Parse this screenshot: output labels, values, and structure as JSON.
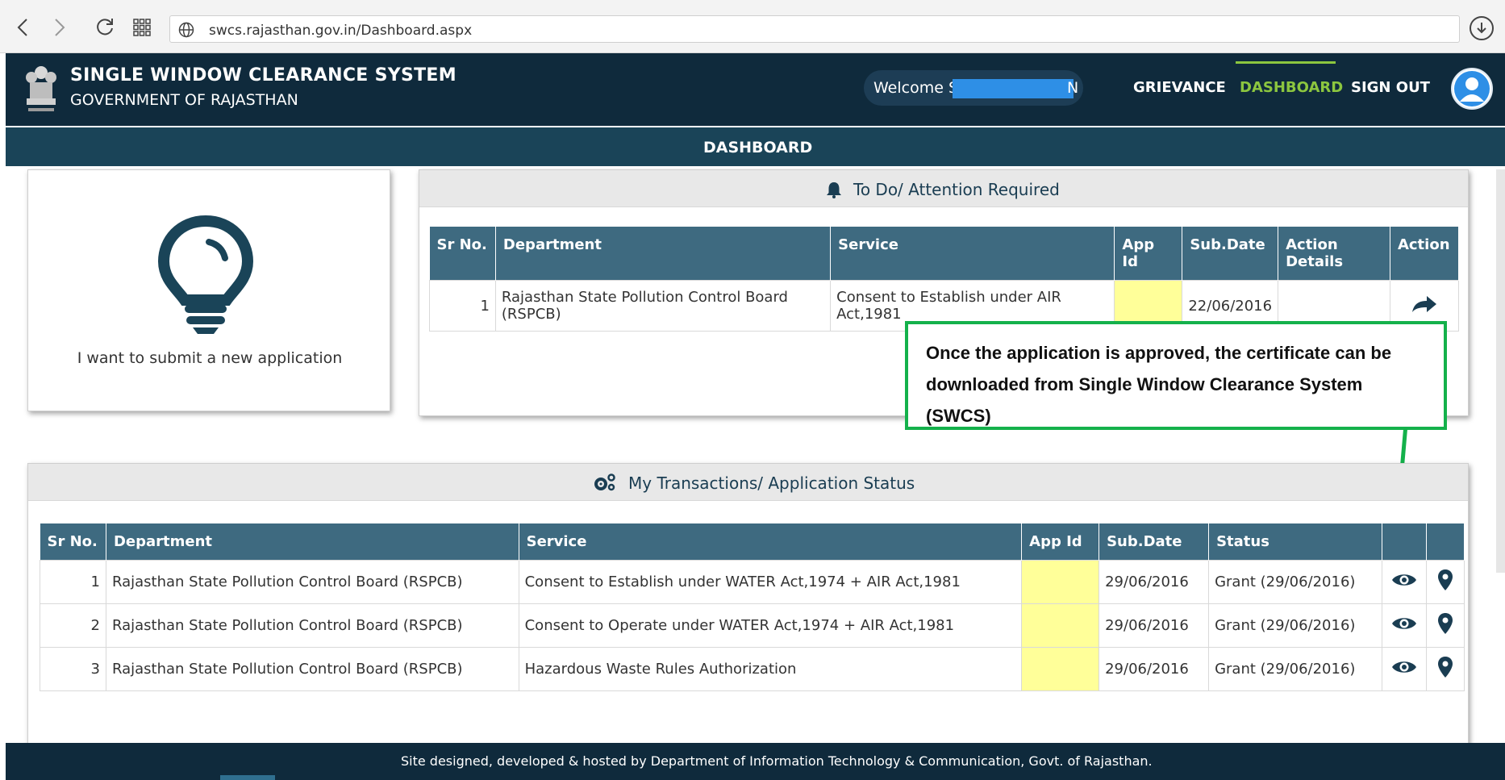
{
  "browser": {
    "url": "swcs.rajasthan.gov.in/Dashboard.aspx"
  },
  "header": {
    "title_line1": "SINGLE WINDOW CLEARANCE SYSTEM",
    "title_line2": "GOVERNMENT OF RAJASTHAN",
    "welcome_prefix": "Welcome S",
    "welcome_suffix": "N",
    "nav": {
      "grievance": "GRIEVANCE",
      "dashboard": "DASHBOARD",
      "signout": "SIGN OUT"
    }
  },
  "dashboard_title": "DASHBOARD",
  "new_application": {
    "label": "I want to submit a new application"
  },
  "todo": {
    "title": "To Do/ Attention Required",
    "columns": [
      "Sr No.",
      "Department",
      "Service",
      "App Id",
      "Sub.Date",
      "Action Details",
      "Action"
    ],
    "rows": [
      {
        "sr": "1",
        "department": "Rajasthan State Pollution Control Board (RSPCB)",
        "service": "Consent to Establish under AIR Act,1981",
        "app_id": "",
        "sub_date": "22/06/2016",
        "action_details": ""
      }
    ]
  },
  "callout": {
    "text": "Once the application is approved, the certificate can be downloaded from Single Window Clearance System (SWCS)"
  },
  "transactions": {
    "title": "My Transactions/ Application Status",
    "columns": [
      "Sr No.",
      "Department",
      "Service",
      "App Id",
      "Sub.Date",
      "Status",
      "",
      ""
    ],
    "rows": [
      {
        "sr": "1",
        "department": "Rajasthan State Pollution Control Board (RSPCB)",
        "service": "Consent to Establish under WATER Act,1974 + AIR Act,1981",
        "app_id": "",
        "sub_date": "29/06/2016",
        "status": "Grant (29/06/2016)"
      },
      {
        "sr": "2",
        "department": "Rajasthan State Pollution Control Board (RSPCB)",
        "service": "Consent to Operate under WATER Act,1974 + AIR Act,1981",
        "app_id": "",
        "sub_date": "29/06/2016",
        "status": "Grant (29/06/2016)"
      },
      {
        "sr": "3",
        "department": "Rajasthan State Pollution Control Board (RSPCB)",
        "service": "Hazardous Waste Rules Authorization",
        "app_id": "",
        "sub_date": "29/06/2016",
        "status": "Grant (29/06/2016)"
      }
    ]
  },
  "footer": {
    "text": "Site designed, developed & hosted by Department of Information Technology & Communication, Govt. of Rajasthan."
  },
  "colors": {
    "header_bg": "#0f2a3c",
    "title_bar_bg": "#1a4458",
    "table_header_bg": "#3e6a80",
    "active_nav": "#8cc63f",
    "callout_border": "#14b14b",
    "highlight": "#ffff99",
    "redaction": "#2e8fe6"
  },
  "icons": {
    "back": "chevron-left-icon",
    "forward": "chevron-right-icon",
    "refresh": "refresh-icon",
    "apps": "apps-grid-icon",
    "site": "globe-icon",
    "download": "download-icon",
    "emblem": "state-emblem-icon",
    "avatar": "user-avatar-icon",
    "new_application": "lightbulb-icon",
    "todo": "bell-icon",
    "transactions": "gears-icon",
    "todo_action": "share-arrow-icon",
    "view": "eye-icon",
    "track": "map-marker-icon"
  }
}
